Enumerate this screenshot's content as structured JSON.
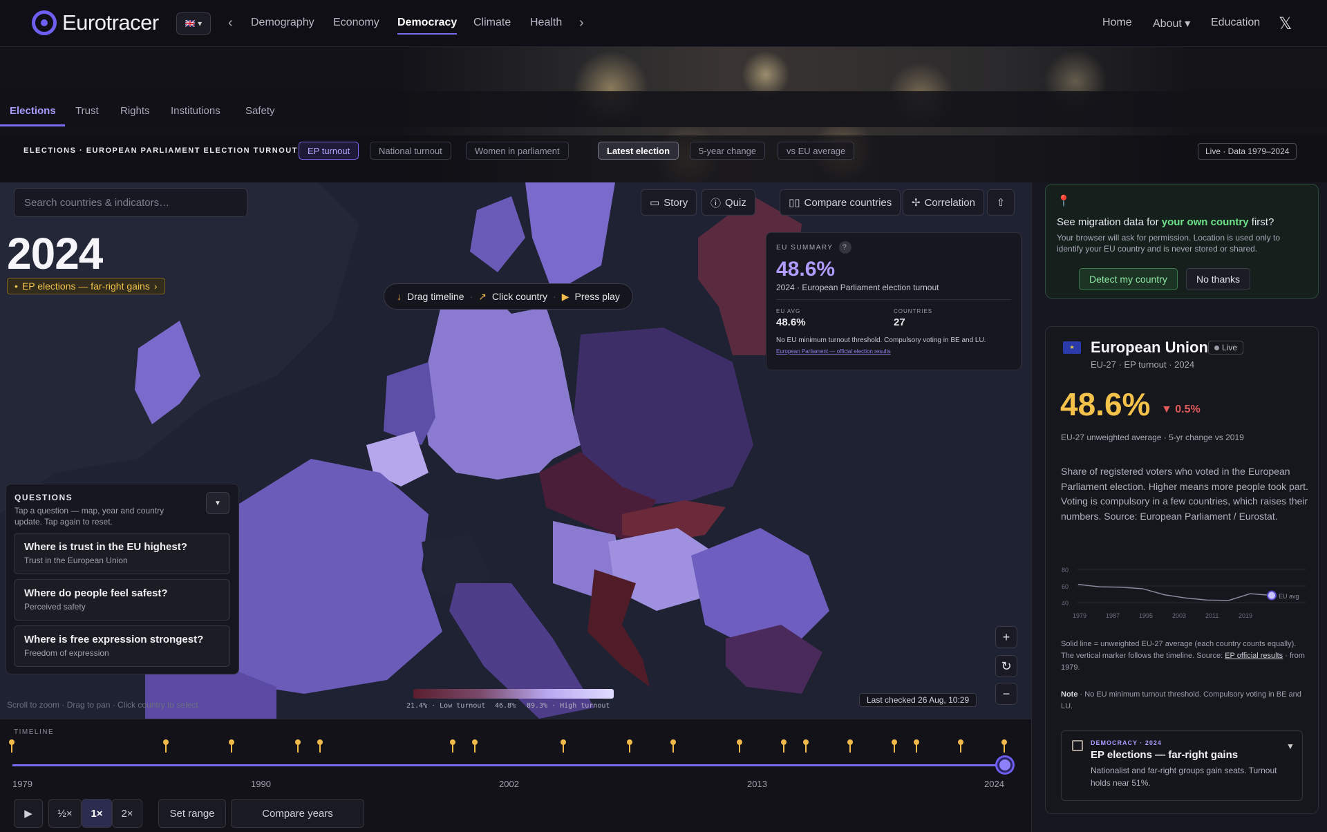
{
  "nav": {
    "brand": "Eurotracer",
    "flag": "🇬🇧 ▾",
    "prev": "‹",
    "next": "›",
    "sections": [
      "Demography",
      "Economy",
      "Democracy",
      "Climate",
      "Health"
    ],
    "active_section": "Democracy",
    "right": [
      "Home",
      "About ▾",
      "Education"
    ],
    "social": "𝕏"
  },
  "subtabs": {
    "items": [
      "Elections",
      "Trust",
      "Rights",
      "Institutions",
      "Safety"
    ],
    "active": "Elections"
  },
  "indicator_bar": {
    "label": "ELECTIONS · EUROPEAN PARLIAMENT ELECTION TURNOUT",
    "metrics": [
      "EP turnout",
      "National turnout",
      "Women in parliament"
    ],
    "views": [
      "Latest election",
      "5-year change",
      "vs EU average"
    ],
    "live": "Live · Data 1979–2024"
  },
  "toolbar": {
    "search_placeholder": "Search countries & indicators…",
    "story": "Story",
    "quiz": "Quiz",
    "compare": "Compare countries",
    "correlation": "Correlation"
  },
  "map": {
    "year": "2024",
    "event_chip": "EP elections — far-right gains",
    "hints": [
      "Drag timeline",
      "Click country",
      "Press play"
    ],
    "help": "Scroll to zoom  ·  Drag to pan  ·  Click country to select",
    "legend": {
      "low": "21.4% · Low turnout",
      "mid": "46.8%",
      "high": "89.3% · High turnout"
    },
    "last_checked": "Last checked 26 Aug, 10:29"
  },
  "summary": {
    "heading": "EU SUMMARY",
    "value": "48.6%",
    "subtitle": "2024 · European Parliament election turnout",
    "avg_label": "EU AVG",
    "avg_value": "48.6%",
    "countries_label": "COUNTRIES",
    "countries_value": "27",
    "note": "No EU minimum turnout threshold. Compulsory voting in BE and LU.",
    "link": "European Parliament — official election results"
  },
  "questions": {
    "title": "QUESTIONS",
    "desc": "Tap a question — map, year and country update. Tap again to reset.",
    "items": [
      {
        "q": "Where is trust in the EU highest?",
        "s": "Trust in the European Union"
      },
      {
        "q": "Where do people feel safest?",
        "s": "Perceived safety"
      },
      {
        "q": "Where is free expression strongest?",
        "s": "Freedom of expression"
      }
    ]
  },
  "timeline": {
    "label": "TIMELINE",
    "years": [
      "1979",
      "1990",
      "2002",
      "2013",
      "2024"
    ],
    "controls": [
      "▶",
      "½×",
      "1×",
      "2×",
      "Set range",
      "Compare years"
    ],
    "active_speed": "1×"
  },
  "migration": {
    "title_pre": "See migration data for ",
    "title_em": "your own country",
    "title_post": " first?",
    "desc": "Your browser will ask for permission. Location is used only to identify your EU country and is never stored or shared.",
    "detect": "Detect my country",
    "no": "No thanks"
  },
  "eu_panel": {
    "name": "European Union",
    "live": "Live",
    "sub": "EU-27 · EP turnout · 2024",
    "value": "48.6%",
    "change": "▼ 0.5%",
    "avg_note": "EU-27 unweighted average · 5-yr change vs 2019",
    "desc": "Share of registered voters who voted in the European Parliament election. Higher means more people took part. Voting is compulsory in a few countries, which raises their numbers. Source: European Parliament / Eurostat.",
    "foot_pre": "Solid line = unweighted EU-27 average (each country counts equally). The vertical marker follows the timeline. Source: ",
    "foot_link": "EP official results",
    "foot_post": " · from 1979.",
    "note_label": "Note",
    "note": " · No EU minimum turnout threshold. Compulsory voting in BE and LU.",
    "event_tag": "DEMOCRACY · 2024",
    "event_title": "EP elections — far-right gains",
    "event_desc": "Nationalist and far-right groups gain seats. Turnout holds near 51%."
  },
  "chart_data": {
    "type": "line",
    "x": [
      1979,
      1984,
      1989,
      1994,
      1999,
      2004,
      2009,
      2014,
      2019,
      2024
    ],
    "series": [
      {
        "values": [
          62,
          59,
          58.5,
          56.7,
          49.5,
          45.5,
          43,
          42.6,
          50.7,
          48.6
        ]
      }
    ],
    "tick_labels_x": [
      "1979",
      "1987",
      "1995",
      "2003",
      "2011",
      "2019"
    ],
    "tick_labels_y": [
      "80",
      "60",
      "40"
    ],
    "ylim": [
      40,
      80
    ],
    "marker_label": "EU avg"
  },
  "colors": {
    "accent": "#7b6cf6",
    "gold": "#f4c24a",
    "negative": "#e05a5a",
    "green": "#6fe08a"
  }
}
